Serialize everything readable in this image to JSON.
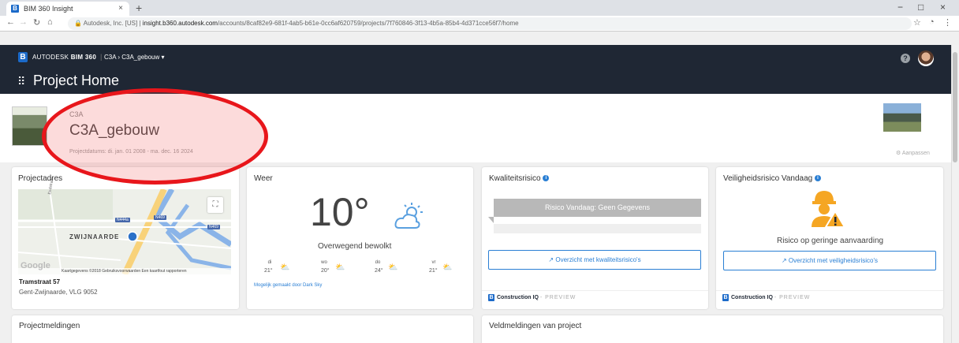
{
  "browser": {
    "tab_title": "BIM 360 Insight",
    "tab_close": "×",
    "new_tab": "+",
    "url_prefix": "Autodesk, Inc. [US]",
    "url_host": "insight.b360.autodesk.com",
    "url_path": "/accounts/8caf82e9-681f-4ab5-b61e-0cc6af620759/projects/7f760846-3f13-4b5a-85b4-4d371cce56f7/home",
    "minimize": "−",
    "maximize": "□",
    "close": "×"
  },
  "header": {
    "brand_prefix": "AUTODESK",
    "brand_product": "BIM 360",
    "breadcrumb": "C3A › C3A_gebouw ▾",
    "page_title": "Project Home",
    "help": "?"
  },
  "project": {
    "subtitle": "C3A",
    "name": "C3A_gebouw",
    "dates": "Projectdatums: di. jan. 01 2008 - ma. dec. 16 2024",
    "customize": "Aanpassen"
  },
  "address_card": {
    "title": "Projectadres",
    "street": "Tramstraat 57",
    "city": "Gent-Zwijnaarde, VLG 9052",
    "map_place": "ZWIJNAARDE",
    "map_google": "Google",
    "map_footer": "Kaartgegevens ©2018   Gebruiksvoorwaarden   Een kaartfout rapporteren",
    "road_labels": [
      "N444a",
      "N469",
      "N469"
    ],
    "street_label": "Eedstraat"
  },
  "weather_card": {
    "title": "Weer",
    "temperature": "10°",
    "description": "Overwegend bewolkt",
    "forecast": [
      {
        "day": "di",
        "temp": "21°"
      },
      {
        "day": "wo",
        "temp": "20°"
      },
      {
        "day": "do",
        "temp": "24°"
      },
      {
        "day": "vr",
        "temp": "21°"
      }
    ],
    "credit": "Mogelijk gemaakt door",
    "credit_link": "Dark Sky"
  },
  "quality_card": {
    "title": "Kwaliteitsrisico",
    "risk_today": "Risico Vandaag: Geen Gegevens",
    "overview_button": "Overzicht met kwaliteitsrisico's",
    "footer_brand": "Construction IQ",
    "footer_tag": "- PREVIEW"
  },
  "safety_card": {
    "title": "Veiligheidsrisico Vandaag",
    "status": "Risico op geringe aanvaarding",
    "overview_button": "Overzicht met veiligheidsrisico's",
    "footer_brand": "Construction IQ",
    "footer_tag": "- PREVIEW"
  },
  "bottom": {
    "project_notices": "Projectmeldingen",
    "field_notices": "Veldmeldingen van project"
  },
  "colors": {
    "header_bg": "#1f2734",
    "accent": "#2a7fd4",
    "annotation": "#e8161b",
    "warning": "#f5a623"
  }
}
